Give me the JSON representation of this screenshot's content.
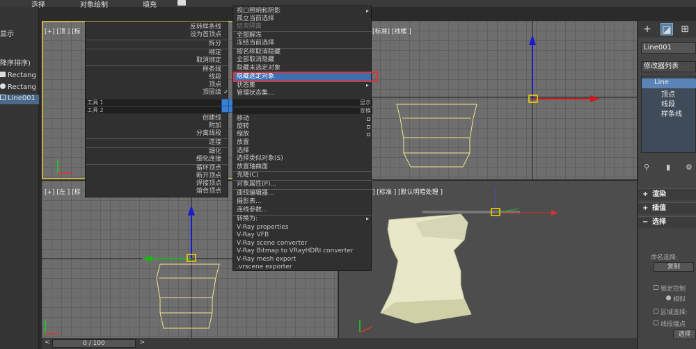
{
  "menubar": {
    "select": "选择",
    "object_paint": "对象绘制",
    "fill": "填充"
  },
  "scene_explorer": {
    "display_label": "显示",
    "sort_label": "降序排序)",
    "items": [
      {
        "name": "Rectang"
      },
      {
        "name": "Rectang"
      },
      {
        "name": "Line001"
      }
    ]
  },
  "viewports": {
    "top_label": "[+] [顶 ] [标",
    "front_label": "[标准] [线框 ]",
    "left_label": "[+] [左 ] [标",
    "persp_label": "] [标准 ] [默认明暗处理 ]"
  },
  "quad_left": {
    "items": [
      "反转样条线",
      "设为首顶点",
      "拆分",
      "绑定",
      "取消绑定",
      "样条线",
      "线段",
      "顶点",
      "顶层级"
    ],
    "tools1": "工具 1",
    "tools2": "工具 2",
    "lower_items": [
      "创建线",
      "附加",
      "分离线段",
      "连接",
      "细化",
      "细化连接",
      "循环顶点",
      "断开顶点",
      "焊接顶点",
      "熔合顶点"
    ]
  },
  "quad_right": {
    "items": [
      "视口照明和阴影",
      "孤立当前选择",
      "结束隔离",
      "全部解冻",
      "冻结当前选择",
      "按名称取消隐藏",
      "全部取消隐藏",
      "隐藏未选定对象",
      "隐藏选定对象",
      "状态集",
      "管理状态集..."
    ],
    "display_header": "显示",
    "transform_header": "变换",
    "lower_items": [
      "移动",
      "旋转",
      "缩放",
      "放置",
      "选择",
      "选择类似对象(S)",
      "放置轴曲面",
      "克隆(C)",
      "对象属性(P)...",
      "曲线编辑器...",
      "摄影表...",
      "连线参数...",
      "转换为:",
      "V-Ray properties",
      "V-Ray VFB",
      "V-Ray scene converter",
      "V-Ray Bitmap to VRayHDRI converter",
      "V-Ray mesh export",
      ".vrscene exporter"
    ]
  },
  "command_panel": {
    "object_name": "Line001",
    "modifier_list": "修改器列表",
    "stack": [
      "Line",
      "顶点",
      "线段",
      "样条线"
    ],
    "rollouts": [
      "渲染",
      "插值",
      "选择"
    ],
    "named_sel_label": "命名选择:",
    "copy_button": "复制",
    "lock_label": "锁定控制",
    "similar_label": "相似",
    "area_label": "区域选择:",
    "segment_end_label": "线段端点",
    "select_button": "选择"
  },
  "timeline": {
    "position": "0 / 100"
  }
}
